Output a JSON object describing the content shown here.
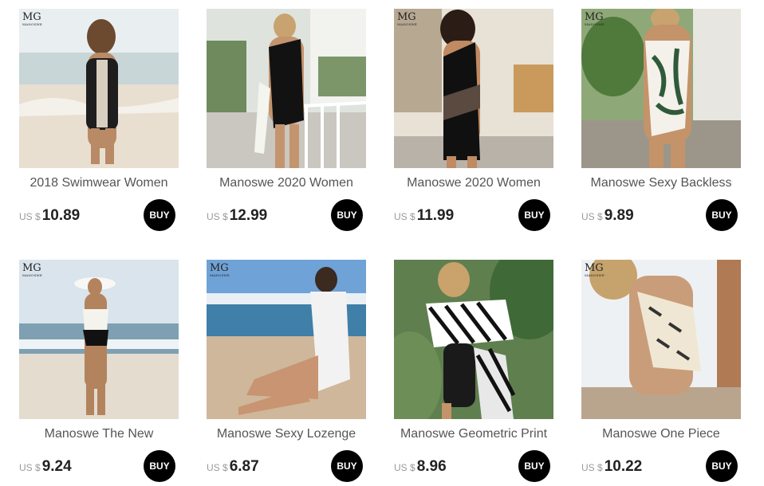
{
  "currency": "US $",
  "buy_label": "BUY",
  "brand_mark": {
    "letters": "MG",
    "sub": "MANOSWE"
  },
  "products": [
    {
      "title": "2018 Swimwear Women",
      "price": "10.89",
      "image": "woman-zipper-lace-swimsuit-beach"
    },
    {
      "title": "Manoswe 2020 Women",
      "price": "12.99",
      "image": "woman-black-one-shoulder-bow-swimsuit"
    },
    {
      "title": "Manoswe 2020 Women",
      "price": "11.99",
      "image": "woman-black-mesh-one-shoulder-swimsuit"
    },
    {
      "title": "Manoswe Sexy Backless",
      "price": "9.89",
      "image": "woman-leaf-print-backless-swimsuit"
    },
    {
      "title": "Manoswe The New",
      "price": "9.24",
      "image": "woman-sun-hat-bustier-swimsuit-beach"
    },
    {
      "title": "Manoswe Sexy Lozenge",
      "price": "6.87",
      "image": "woman-white-mesh-longsleeve-swimsuit-beach"
    },
    {
      "title": "Manoswe Geometric Print",
      "price": "8.96",
      "image": "woman-geometric-off-shoulder-swimsuit"
    },
    {
      "title": "Manoswe One Piece",
      "price": "10.22",
      "image": "woman-printed-halter-swimsuit-rocks"
    }
  ]
}
